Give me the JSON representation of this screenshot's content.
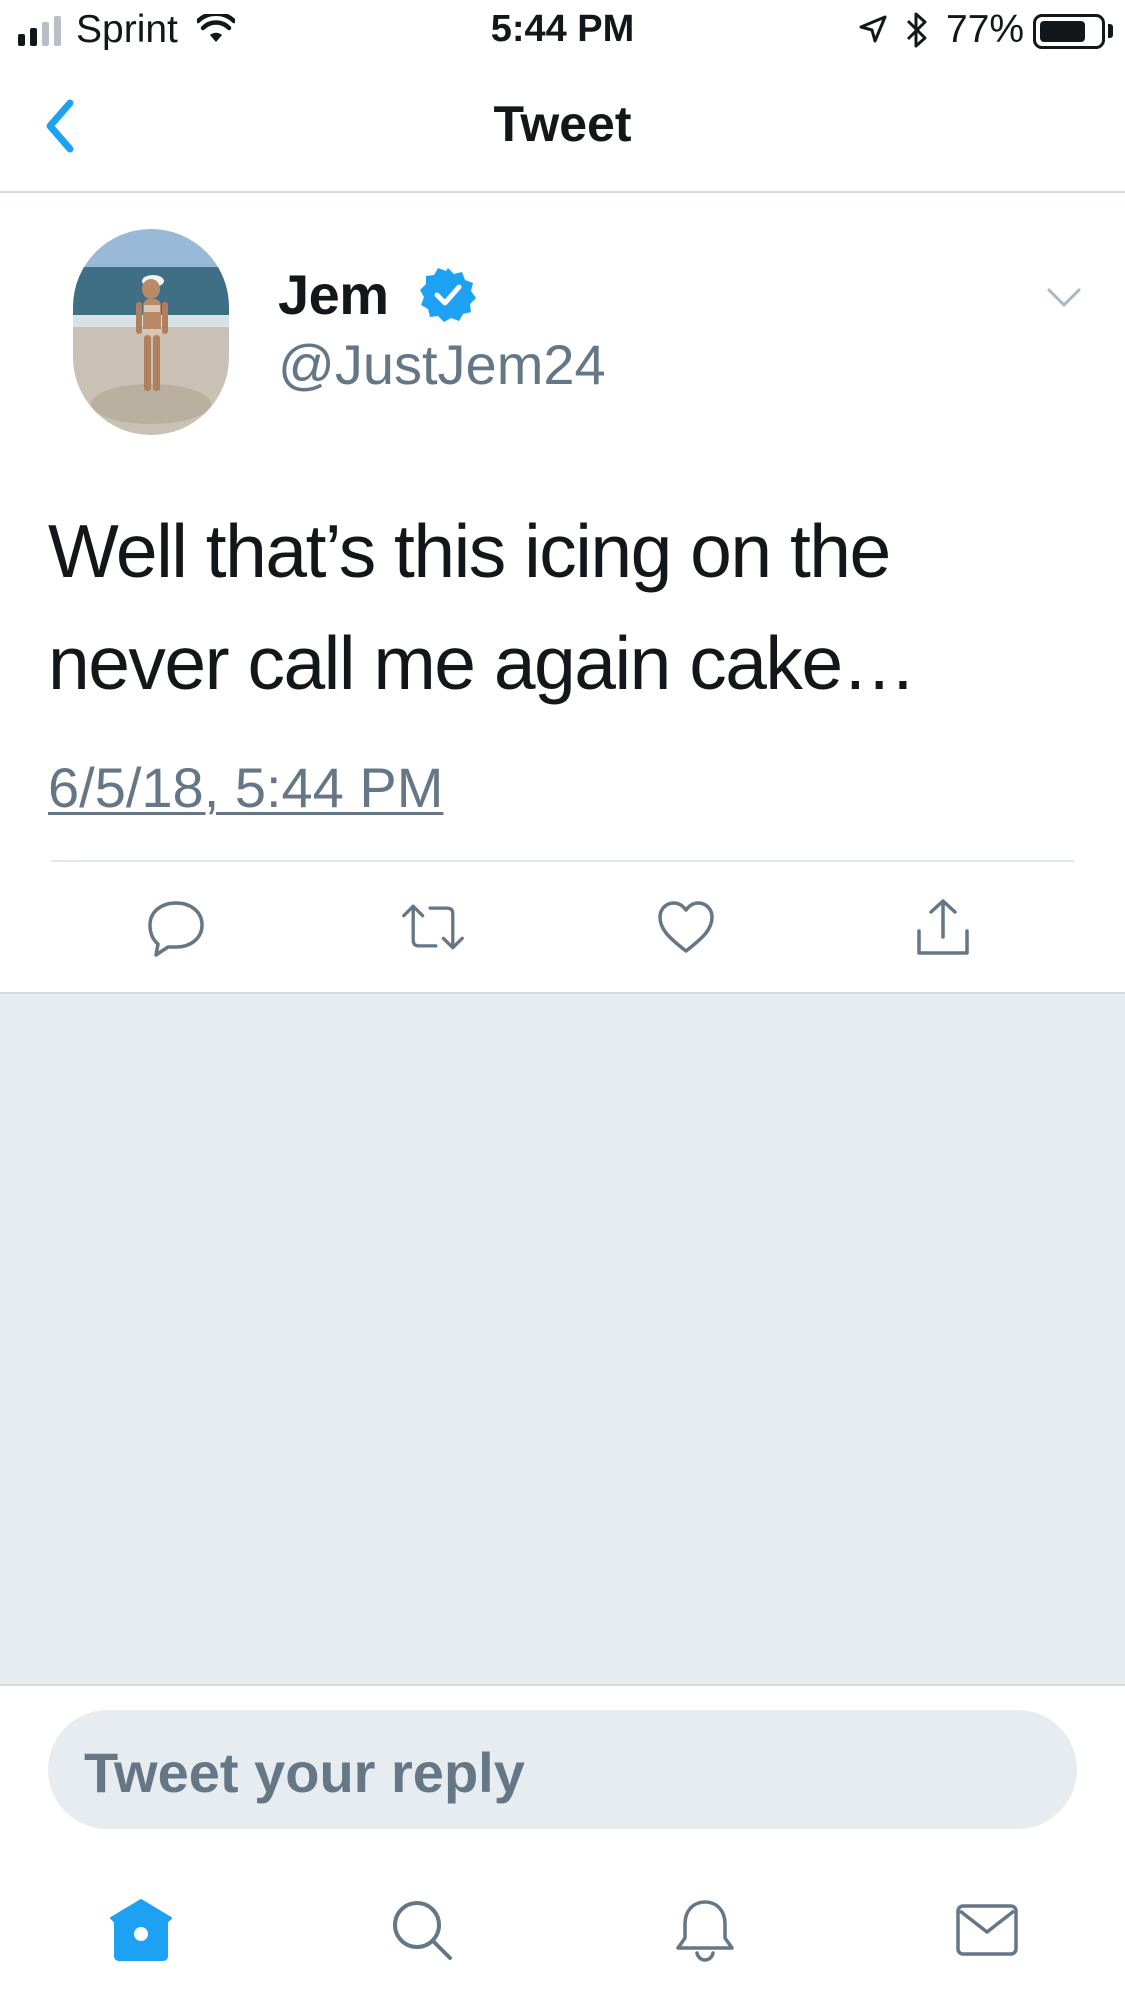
{
  "status_bar": {
    "carrier": "Sprint",
    "time": "5:44 PM",
    "battery_percent": "77%",
    "battery_level": 0.77,
    "signal_bars_filled": 2,
    "signal_bars_total": 4
  },
  "nav": {
    "title": "Tweet",
    "back_icon": "chevron-left-icon"
  },
  "tweet": {
    "display_name": "Jem",
    "verified": true,
    "handle": "@JustJem24",
    "text": "Well that’s this icing on the never call me again cake…",
    "timestamp": "6/5/18, 5:44 PM",
    "actions": [
      "reply-icon",
      "retweet-icon",
      "like-icon",
      "share-icon"
    ]
  },
  "reply": {
    "placeholder": "Tweet your reply"
  },
  "tab_bar": {
    "tabs": [
      "home-icon",
      "search-icon",
      "notifications-icon",
      "messages-icon"
    ],
    "active": "home-icon"
  },
  "colors": {
    "accent": "#1da1f2",
    "secondary_text": "#657786",
    "gray_area": "#e6ecf0"
  }
}
